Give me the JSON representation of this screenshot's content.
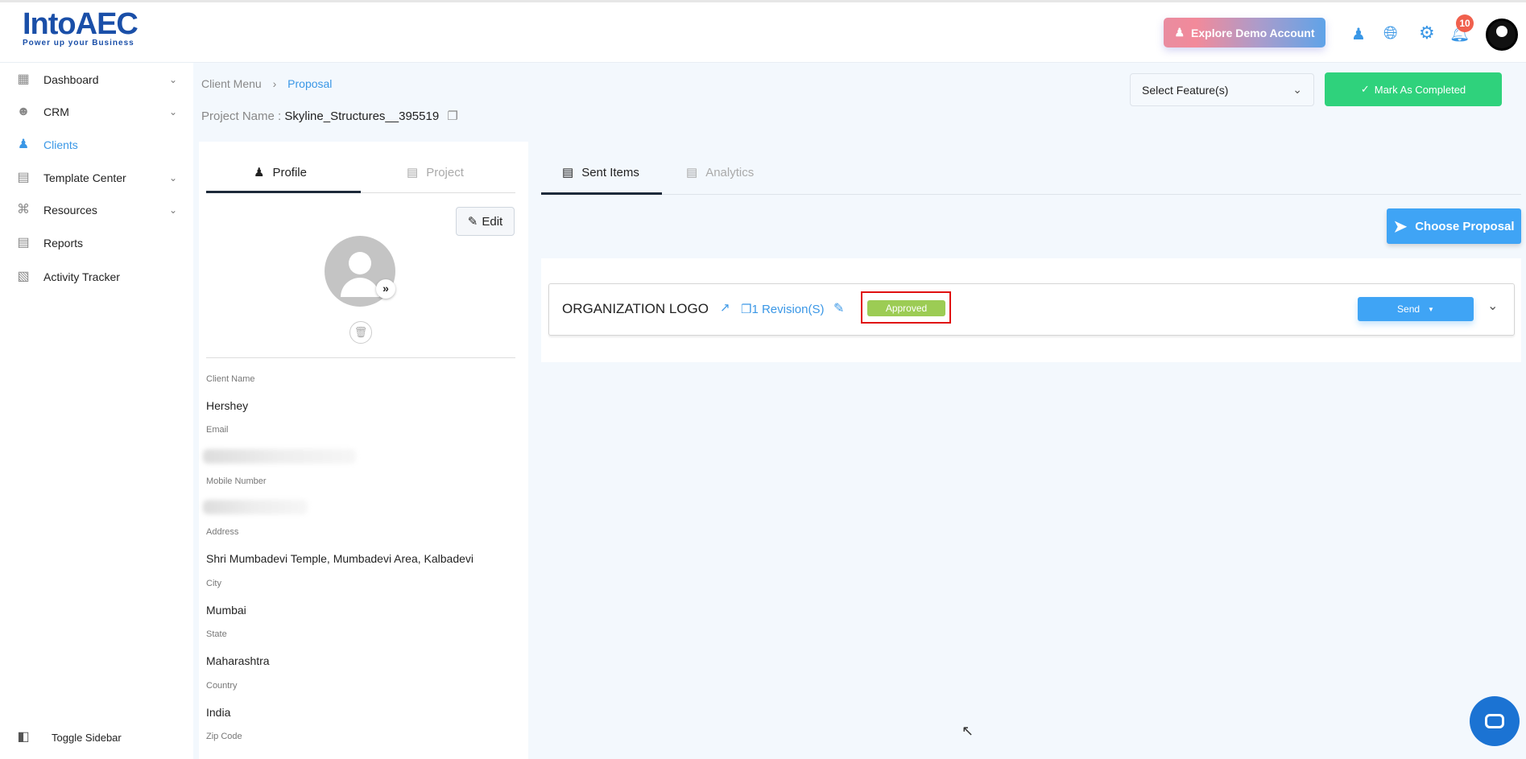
{
  "header": {
    "logo_main": "IntoAEC",
    "logo_tagline": "Power up your Business",
    "explore_button": "Explore Demo Account",
    "notification_count": "10"
  },
  "sidebar": {
    "items": [
      {
        "label": "Dashboard",
        "icon": "dashboard-icon"
      },
      {
        "label": "CRM",
        "icon": "crm-icon"
      },
      {
        "label": "Clients",
        "icon": "clients-icon"
      },
      {
        "label": "Template Center",
        "icon": "template-icon"
      },
      {
        "label": "Resources",
        "icon": "resources-icon"
      },
      {
        "label": "Reports",
        "icon": "reports-icon"
      },
      {
        "label": "Activity Tracker",
        "icon": "activity-icon"
      }
    ],
    "toggle": "Toggle Sidebar"
  },
  "breadcrumb": {
    "parent": "Client Menu",
    "current": "Proposal"
  },
  "project": {
    "label": "Project Name :",
    "name": "Skyline_Structures__395519"
  },
  "toolbar": {
    "select_placeholder": "Select Feature(s)",
    "mark_completed": "Mark As Completed"
  },
  "profile": {
    "tabs": [
      "Profile",
      "Project"
    ],
    "edit": "Edit",
    "fields": [
      {
        "label": "Client Name",
        "value": "Hershey"
      },
      {
        "label": "Email",
        "value": null
      },
      {
        "label": "Mobile Number",
        "value": null
      },
      {
        "label": "Address",
        "value": "Shri Mumbadevi Temple, Mumbadevi Area, Kalbadevi"
      },
      {
        "label": "City",
        "value": "Mumbai"
      },
      {
        "label": "State",
        "value": "Maharashtra"
      },
      {
        "label": "Country",
        "value": "India"
      },
      {
        "label": "Zip Code",
        "value": null
      }
    ]
  },
  "main": {
    "tabs": [
      "Sent Items",
      "Analytics"
    ],
    "choose_proposal": "Choose Proposal",
    "item": {
      "title": "ORGANIZATION LOGO",
      "revisions": "1 Revision(S)",
      "status": "Approved",
      "send": "Send"
    }
  },
  "colors": {
    "accent": "#3a97e6",
    "green": "#2fd27c",
    "approved": "#9ccc54",
    "badge": "#f0604d"
  }
}
